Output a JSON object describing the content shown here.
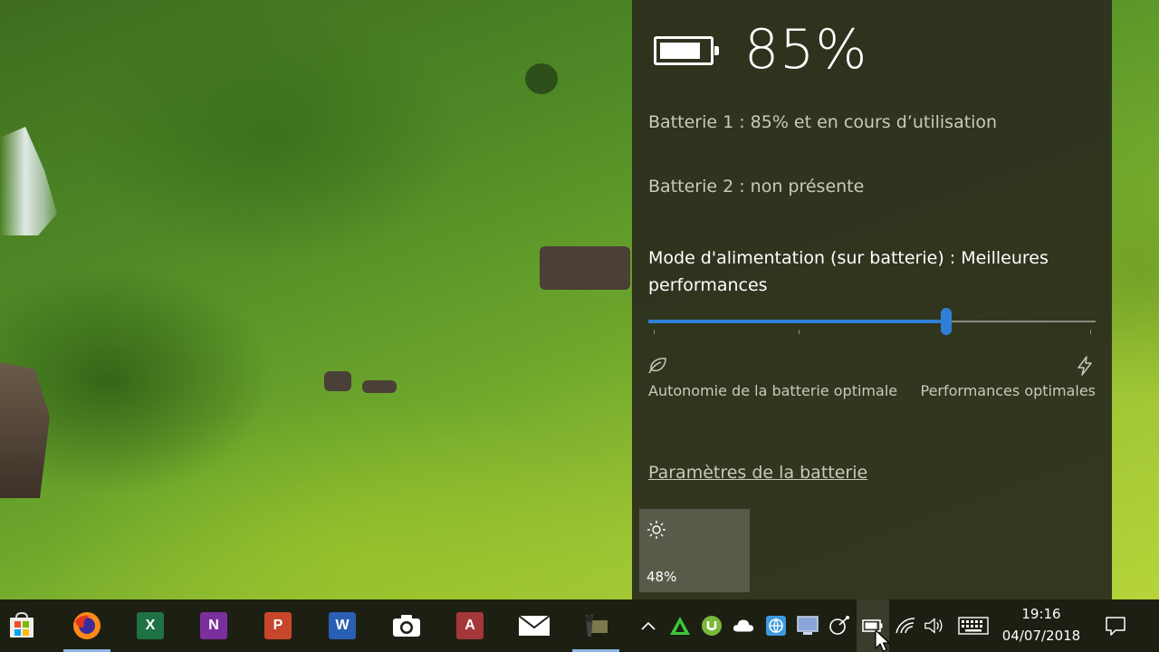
{
  "flyout": {
    "percent": "85%",
    "charge_level": 0.85,
    "battery1": "Batterie 1 : 85% et en cours d’utilisation",
    "battery2": "Batterie 2 : non présente",
    "mode_label": "Mode d'alimentation (sur batterie) : Meilleures performances",
    "slider": {
      "value": 0.665,
      "accent": "#2f7fd6"
    },
    "left_label": "Autonomie de la batterie optimale",
    "right_label": "Performances optimales",
    "settings_link": "Paramètres de la batterie",
    "brightness": {
      "value": "48%",
      "icon": "sun-icon"
    }
  },
  "taskbar": {
    "apps": [
      {
        "name": "start",
        "icon": "windows-store-icon"
      },
      {
        "name": "firefox",
        "icon": "firefox-icon",
        "running": true
      },
      {
        "name": "excel",
        "letter": "X",
        "color": "#1f7244"
      },
      {
        "name": "onenote",
        "letter": "N",
        "color": "#7b2f9e"
      },
      {
        "name": "powerpoint",
        "letter": "P",
        "color": "#c8462b"
      },
      {
        "name": "word",
        "letter": "W",
        "color": "#2b5fb4"
      },
      {
        "name": "camera",
        "icon": "camera-icon"
      },
      {
        "name": "access",
        "letter": "A",
        "color": "#a4373a"
      },
      {
        "name": "mail",
        "icon": "mail-icon"
      },
      {
        "name": "video-editor",
        "icon": "film-icon",
        "running": true
      }
    ],
    "clock": {
      "time": "19:16",
      "date": "04/07/2018"
    }
  }
}
